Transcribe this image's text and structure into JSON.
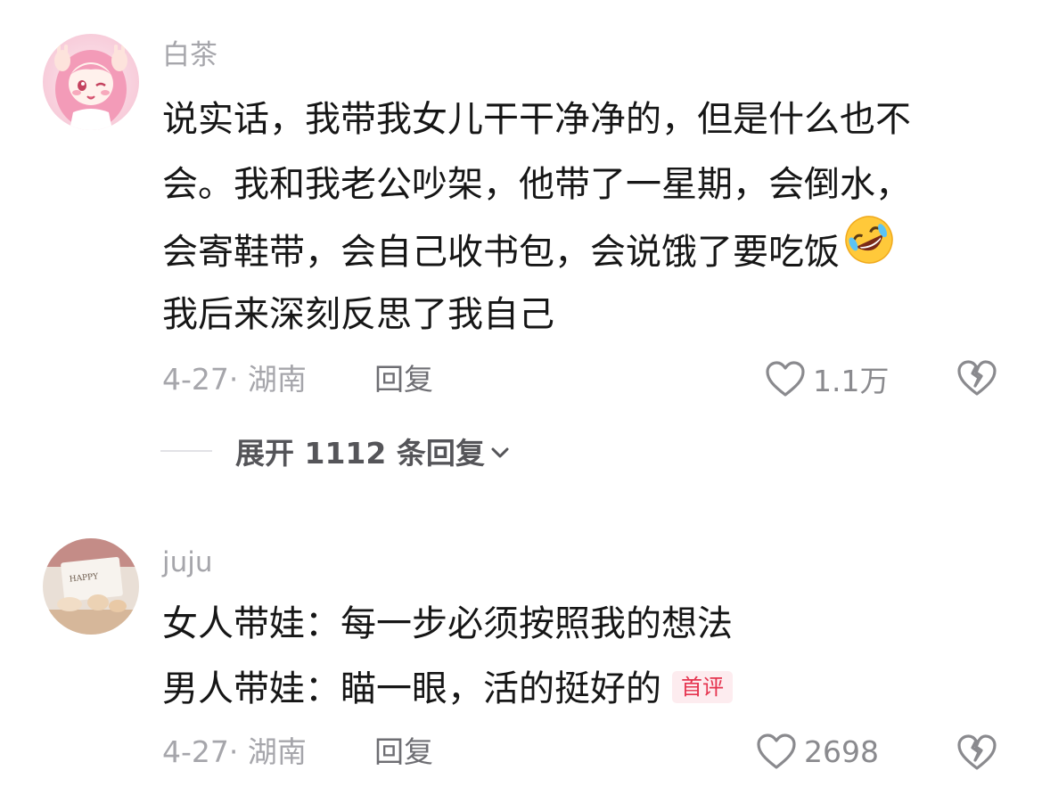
{
  "comments": [
    {
      "username": "白茶",
      "text_lines": [
        "说实话，我带我女儿干干净净的，但是什么也不",
        "会。我和我老公吵架，他带了一星期，会倒水，",
        "会寄鞋带，会自己收书包，会说饿了要吃饭",
        "我后来深刻反思了我自己"
      ],
      "emoji": "rolling-on-floor-laughing-emoji",
      "date_location": "4-27· 湖南",
      "reply_label": "回复",
      "like_count": "1.1万",
      "expand_replies": "展开 1112 条回复"
    },
    {
      "username": "juju",
      "text_lines": [
        "女人带娃：每一步必须按照我的想法",
        "男人带娃：瞄一眼，活的挺好的"
      ],
      "badge": "首评",
      "date_location": "4-27· 湖南",
      "reply_label": "回复",
      "like_count": "2698"
    }
  ],
  "colors": {
    "username": "#a6a6ab",
    "body_text": "#161616",
    "meta": "#a6a6ab",
    "badge_bg": "#fdecef",
    "badge_text": "#e5344f"
  }
}
